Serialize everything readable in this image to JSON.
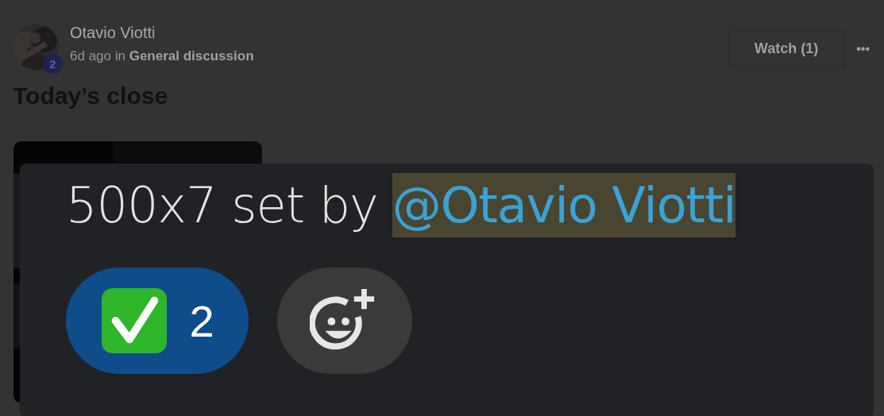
{
  "post": {
    "author": "Otavio Viotti",
    "badge": "2",
    "meta": "6d ago in **General discussion**",
    "title": "Today’s close",
    "watch_button": "Watch (1)",
    "more_button": "•••"
  },
  "zoom_overlay": {
    "text": "500x7 set by",
    "mention": "@Otavio Viotti",
    "reactions": [
      {
        "kind": "check",
        "count": "2",
        "selected": true
      }
    ]
  }
}
